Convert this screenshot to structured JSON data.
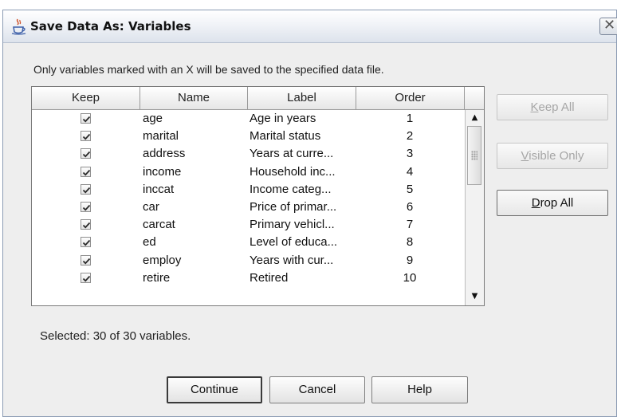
{
  "window": {
    "title": "Save Data As: Variables",
    "icon": "java-cup-icon",
    "close_icon": "close-icon"
  },
  "instructions": "Only variables marked with an X will be saved to the specified data file.",
  "table": {
    "columns": [
      "Keep",
      "Name",
      "Label",
      "Order"
    ],
    "rows": [
      {
        "keep": true,
        "name": "age",
        "label": "Age in years",
        "order": "1"
      },
      {
        "keep": true,
        "name": "marital",
        "label": "Marital status",
        "order": "2"
      },
      {
        "keep": true,
        "name": "address",
        "label": "Years at curre...",
        "order": "3"
      },
      {
        "keep": true,
        "name": "income",
        "label": "Household inc...",
        "order": "4"
      },
      {
        "keep": true,
        "name": "inccat",
        "label": "Income categ...",
        "order": "5"
      },
      {
        "keep": true,
        "name": "car",
        "label": "Price of primar...",
        "order": "6"
      },
      {
        "keep": true,
        "name": "carcat",
        "label": "Primary vehicl...",
        "order": "7"
      },
      {
        "keep": true,
        "name": "ed",
        "label": "Level of educa...",
        "order": "8"
      },
      {
        "keep": true,
        "name": "employ",
        "label": "Years with cur...",
        "order": "9"
      },
      {
        "keep": true,
        "name": "retire",
        "label": "Retired",
        "order": "10"
      }
    ]
  },
  "side_buttons": {
    "keep_all": {
      "mnemonic": "K",
      "rest": "eep All",
      "enabled": false
    },
    "visible_only": {
      "mnemonic": "V",
      "rest": "isible Only",
      "enabled": false
    },
    "drop_all": {
      "mnemonic": "D",
      "rest": "rop All",
      "enabled": true
    }
  },
  "status": "Selected: 30 of 30 variables.",
  "buttons": {
    "continue": "Continue",
    "cancel": "Cancel",
    "help": "Help"
  },
  "colors": {
    "dialog_bg": "#eeeeee",
    "title_border": "#8c9cb4"
  }
}
